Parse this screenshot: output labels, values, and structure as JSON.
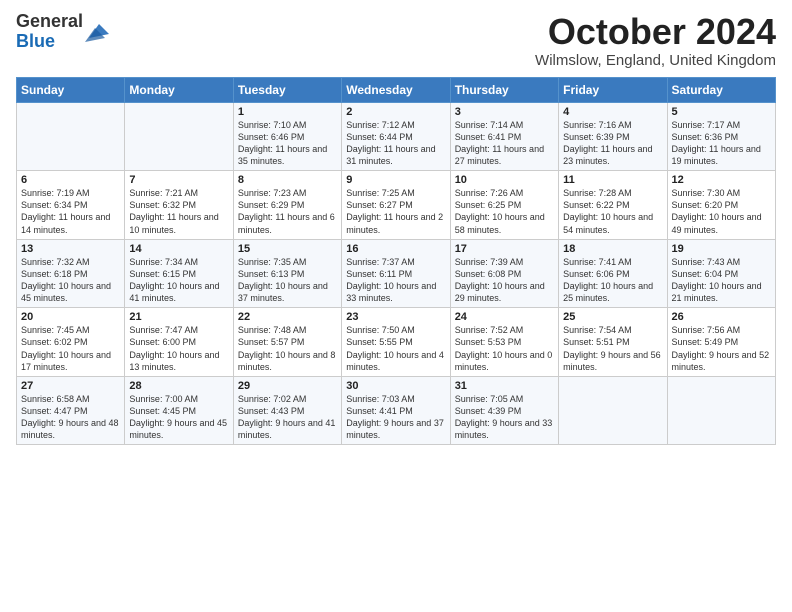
{
  "header": {
    "logo": {
      "line1": "General",
      "line2": "Blue"
    },
    "title": "October 2024",
    "location": "Wilmslow, England, United Kingdom"
  },
  "weekdays": [
    "Sunday",
    "Monday",
    "Tuesday",
    "Wednesday",
    "Thursday",
    "Friday",
    "Saturday"
  ],
  "weeks": [
    [
      {
        "day": "",
        "sunrise": "",
        "sunset": "",
        "daylight": ""
      },
      {
        "day": "",
        "sunrise": "",
        "sunset": "",
        "daylight": ""
      },
      {
        "day": "1",
        "sunrise": "Sunrise: 7:10 AM",
        "sunset": "Sunset: 6:46 PM",
        "daylight": "Daylight: 11 hours and 35 minutes."
      },
      {
        "day": "2",
        "sunrise": "Sunrise: 7:12 AM",
        "sunset": "Sunset: 6:44 PM",
        "daylight": "Daylight: 11 hours and 31 minutes."
      },
      {
        "day": "3",
        "sunrise": "Sunrise: 7:14 AM",
        "sunset": "Sunset: 6:41 PM",
        "daylight": "Daylight: 11 hours and 27 minutes."
      },
      {
        "day": "4",
        "sunrise": "Sunrise: 7:16 AM",
        "sunset": "Sunset: 6:39 PM",
        "daylight": "Daylight: 11 hours and 23 minutes."
      },
      {
        "day": "5",
        "sunrise": "Sunrise: 7:17 AM",
        "sunset": "Sunset: 6:36 PM",
        "daylight": "Daylight: 11 hours and 19 minutes."
      }
    ],
    [
      {
        "day": "6",
        "sunrise": "Sunrise: 7:19 AM",
        "sunset": "Sunset: 6:34 PM",
        "daylight": "Daylight: 11 hours and 14 minutes."
      },
      {
        "day": "7",
        "sunrise": "Sunrise: 7:21 AM",
        "sunset": "Sunset: 6:32 PM",
        "daylight": "Daylight: 11 hours and 10 minutes."
      },
      {
        "day": "8",
        "sunrise": "Sunrise: 7:23 AM",
        "sunset": "Sunset: 6:29 PM",
        "daylight": "Daylight: 11 hours and 6 minutes."
      },
      {
        "day": "9",
        "sunrise": "Sunrise: 7:25 AM",
        "sunset": "Sunset: 6:27 PM",
        "daylight": "Daylight: 11 hours and 2 minutes."
      },
      {
        "day": "10",
        "sunrise": "Sunrise: 7:26 AM",
        "sunset": "Sunset: 6:25 PM",
        "daylight": "Daylight: 10 hours and 58 minutes."
      },
      {
        "day": "11",
        "sunrise": "Sunrise: 7:28 AM",
        "sunset": "Sunset: 6:22 PM",
        "daylight": "Daylight: 10 hours and 54 minutes."
      },
      {
        "day": "12",
        "sunrise": "Sunrise: 7:30 AM",
        "sunset": "Sunset: 6:20 PM",
        "daylight": "Daylight: 10 hours and 49 minutes."
      }
    ],
    [
      {
        "day": "13",
        "sunrise": "Sunrise: 7:32 AM",
        "sunset": "Sunset: 6:18 PM",
        "daylight": "Daylight: 10 hours and 45 minutes."
      },
      {
        "day": "14",
        "sunrise": "Sunrise: 7:34 AM",
        "sunset": "Sunset: 6:15 PM",
        "daylight": "Daylight: 10 hours and 41 minutes."
      },
      {
        "day": "15",
        "sunrise": "Sunrise: 7:35 AM",
        "sunset": "Sunset: 6:13 PM",
        "daylight": "Daylight: 10 hours and 37 minutes."
      },
      {
        "day": "16",
        "sunrise": "Sunrise: 7:37 AM",
        "sunset": "Sunset: 6:11 PM",
        "daylight": "Daylight: 10 hours and 33 minutes."
      },
      {
        "day": "17",
        "sunrise": "Sunrise: 7:39 AM",
        "sunset": "Sunset: 6:08 PM",
        "daylight": "Daylight: 10 hours and 29 minutes."
      },
      {
        "day": "18",
        "sunrise": "Sunrise: 7:41 AM",
        "sunset": "Sunset: 6:06 PM",
        "daylight": "Daylight: 10 hours and 25 minutes."
      },
      {
        "day": "19",
        "sunrise": "Sunrise: 7:43 AM",
        "sunset": "Sunset: 6:04 PM",
        "daylight": "Daylight: 10 hours and 21 minutes."
      }
    ],
    [
      {
        "day": "20",
        "sunrise": "Sunrise: 7:45 AM",
        "sunset": "Sunset: 6:02 PM",
        "daylight": "Daylight: 10 hours and 17 minutes."
      },
      {
        "day": "21",
        "sunrise": "Sunrise: 7:47 AM",
        "sunset": "Sunset: 6:00 PM",
        "daylight": "Daylight: 10 hours and 13 minutes."
      },
      {
        "day": "22",
        "sunrise": "Sunrise: 7:48 AM",
        "sunset": "Sunset: 5:57 PM",
        "daylight": "Daylight: 10 hours and 8 minutes."
      },
      {
        "day": "23",
        "sunrise": "Sunrise: 7:50 AM",
        "sunset": "Sunset: 5:55 PM",
        "daylight": "Daylight: 10 hours and 4 minutes."
      },
      {
        "day": "24",
        "sunrise": "Sunrise: 7:52 AM",
        "sunset": "Sunset: 5:53 PM",
        "daylight": "Daylight: 10 hours and 0 minutes."
      },
      {
        "day": "25",
        "sunrise": "Sunrise: 7:54 AM",
        "sunset": "Sunset: 5:51 PM",
        "daylight": "Daylight: 9 hours and 56 minutes."
      },
      {
        "day": "26",
        "sunrise": "Sunrise: 7:56 AM",
        "sunset": "Sunset: 5:49 PM",
        "daylight": "Daylight: 9 hours and 52 minutes."
      }
    ],
    [
      {
        "day": "27",
        "sunrise": "Sunrise: 6:58 AM",
        "sunset": "Sunset: 4:47 PM",
        "daylight": "Daylight: 9 hours and 48 minutes."
      },
      {
        "day": "28",
        "sunrise": "Sunrise: 7:00 AM",
        "sunset": "Sunset: 4:45 PM",
        "daylight": "Daylight: 9 hours and 45 minutes."
      },
      {
        "day": "29",
        "sunrise": "Sunrise: 7:02 AM",
        "sunset": "Sunset: 4:43 PM",
        "daylight": "Daylight: 9 hours and 41 minutes."
      },
      {
        "day": "30",
        "sunrise": "Sunrise: 7:03 AM",
        "sunset": "Sunset: 4:41 PM",
        "daylight": "Daylight: 9 hours and 37 minutes."
      },
      {
        "day": "31",
        "sunrise": "Sunrise: 7:05 AM",
        "sunset": "Sunset: 4:39 PM",
        "daylight": "Daylight: 9 hours and 33 minutes."
      },
      {
        "day": "",
        "sunrise": "",
        "sunset": "",
        "daylight": ""
      },
      {
        "day": "",
        "sunrise": "",
        "sunset": "",
        "daylight": ""
      }
    ]
  ]
}
